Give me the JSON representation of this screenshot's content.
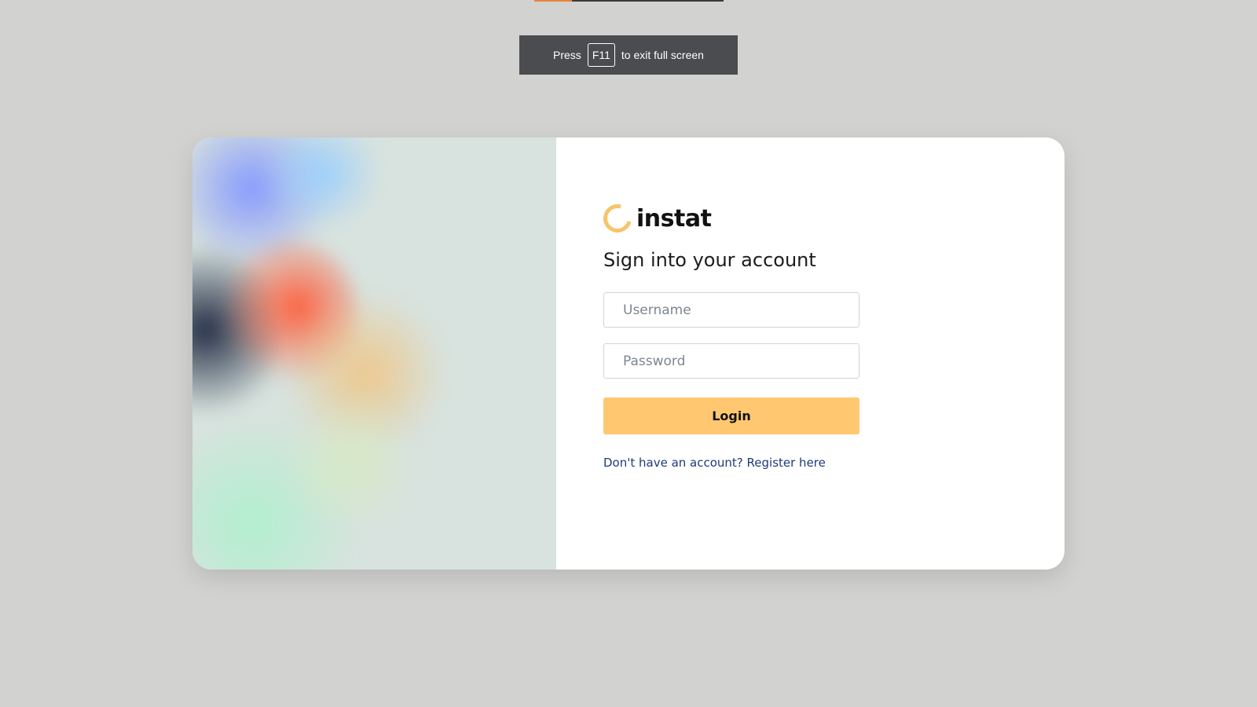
{
  "browser": {
    "top_progress_fraction": 0.2,
    "progress_color": "#e8833a",
    "fullscreen_notice": {
      "before": "Press",
      "key": "F11",
      "after": "to exit full screen"
    }
  },
  "brand": {
    "name": "instat",
    "icon": "ring-logo-icon",
    "accent_color": "#f7c46a"
  },
  "login": {
    "title": "Sign into your account",
    "username_placeholder": "Username",
    "username_value": "",
    "password_placeholder": "Password",
    "password_value": "",
    "submit_label": "Login",
    "submit_color": "#ffc870",
    "register_text": "Don't have an account? Register here"
  }
}
